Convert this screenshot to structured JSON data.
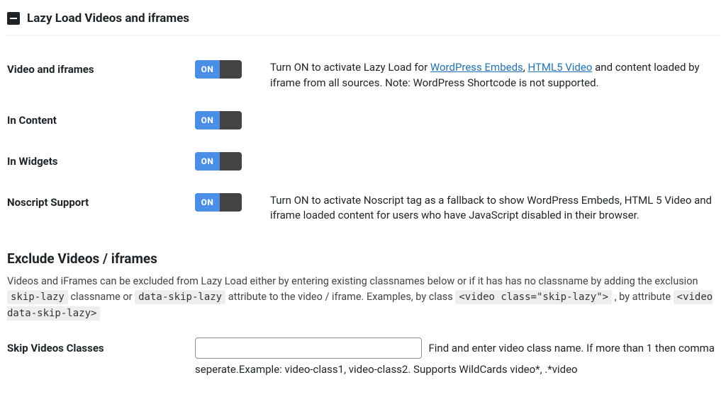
{
  "section": {
    "title": "Lazy Load Videos and iframes"
  },
  "toggle_label": "ON",
  "rows": {
    "video_iframes": {
      "label": "Video and iframes",
      "desc_pre": "Turn ON to activate Lazy Load for ",
      "link1": "WordPress Embeds",
      "sep1": ", ",
      "link2": "HTML5 Video",
      "desc_post": " and content loaded by iframe from all sources. Note: WordPress Shortcode is not supported."
    },
    "in_content": {
      "label": "In Content"
    },
    "in_widgets": {
      "label": "In Widgets"
    },
    "noscript": {
      "label": "Noscript Support",
      "desc": "Turn ON to activate Noscript tag as a fallback to show WordPress Embeds, HTML 5 Video and iframe loaded content for users who have JavaScript disabled in their browser."
    }
  },
  "exclude": {
    "title": "Exclude Videos / iframes",
    "desc_p1": "Videos and iFrames can be excluded from Lazy Load either by entering existing classnames below or if it has has no classname by adding the exclusion ",
    "code1": "skip-lazy",
    "desc_p2": " classname or ",
    "code2": "data-skip-lazy",
    "desc_p3": " attribute to the video / iframe. Examples, by class ",
    "code3": "<video class=\"skip-lazy\">",
    "desc_p4": " , by attribute ",
    "code4": "<video data-skip-lazy>"
  },
  "skip_classes": {
    "label": "Skip Videos Classes",
    "help_inline": "Find and enter video class name. If more than 1 then comma",
    "help_block": "seperate.Example: video-class1, video-class2. Supports WildCards video*, .*video"
  }
}
